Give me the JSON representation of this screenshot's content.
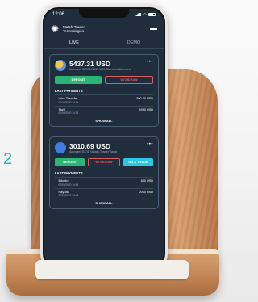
{
  "step_number": "2",
  "status_bar": {
    "time": "12:06"
  },
  "app": {
    "brand_name": "Match-Trader Technologies"
  },
  "tabs": [
    {
      "label": "LIVE",
      "active": true
    },
    {
      "label": "DEMO",
      "active": false
    }
  ],
  "accounts": [
    {
      "balance": "5437.31 USD",
      "description": "Account: 900000192, MT4 Standard Account",
      "buttons": {
        "deposit": "DEPOSIT",
        "withdraw": "WITHDRAW"
      },
      "payments_title": "LAST PAYMENTS",
      "payments": [
        {
          "name": "Wire Transfer",
          "date": "02/09/2020 14:44",
          "amount": "500.00 USD"
        },
        {
          "name": "Skrill",
          "date": "02/09/2020 14:38",
          "amount": "4950 USD"
        }
      ],
      "show_all": "SHOW ALL"
    },
    {
      "balance": "3010.69 USD",
      "description": "Account: 5174, Match-Trader Basic",
      "buttons": {
        "deposit": "DEPOSIT",
        "withdraw": "WITHDRAW",
        "go_trade": "GO & TRADE"
      },
      "payments_title": "LAST PAYMENTS",
      "payments": [
        {
          "name": "Bitcoin",
          "date": "02/09/2020 14:45",
          "amount": "800 USD"
        },
        {
          "name": "Paypal",
          "date": "02/09/2020 14:45",
          "amount": "2000 USD"
        }
      ],
      "show_all": "SHOW ALL"
    }
  ],
  "colors": {
    "screen_bg": "#1f2d3d",
    "accent": "#2cb4ad",
    "deposit": "#2cb574",
    "withdraw": "#e05b5b",
    "go_trade": "#2bc6e3"
  }
}
